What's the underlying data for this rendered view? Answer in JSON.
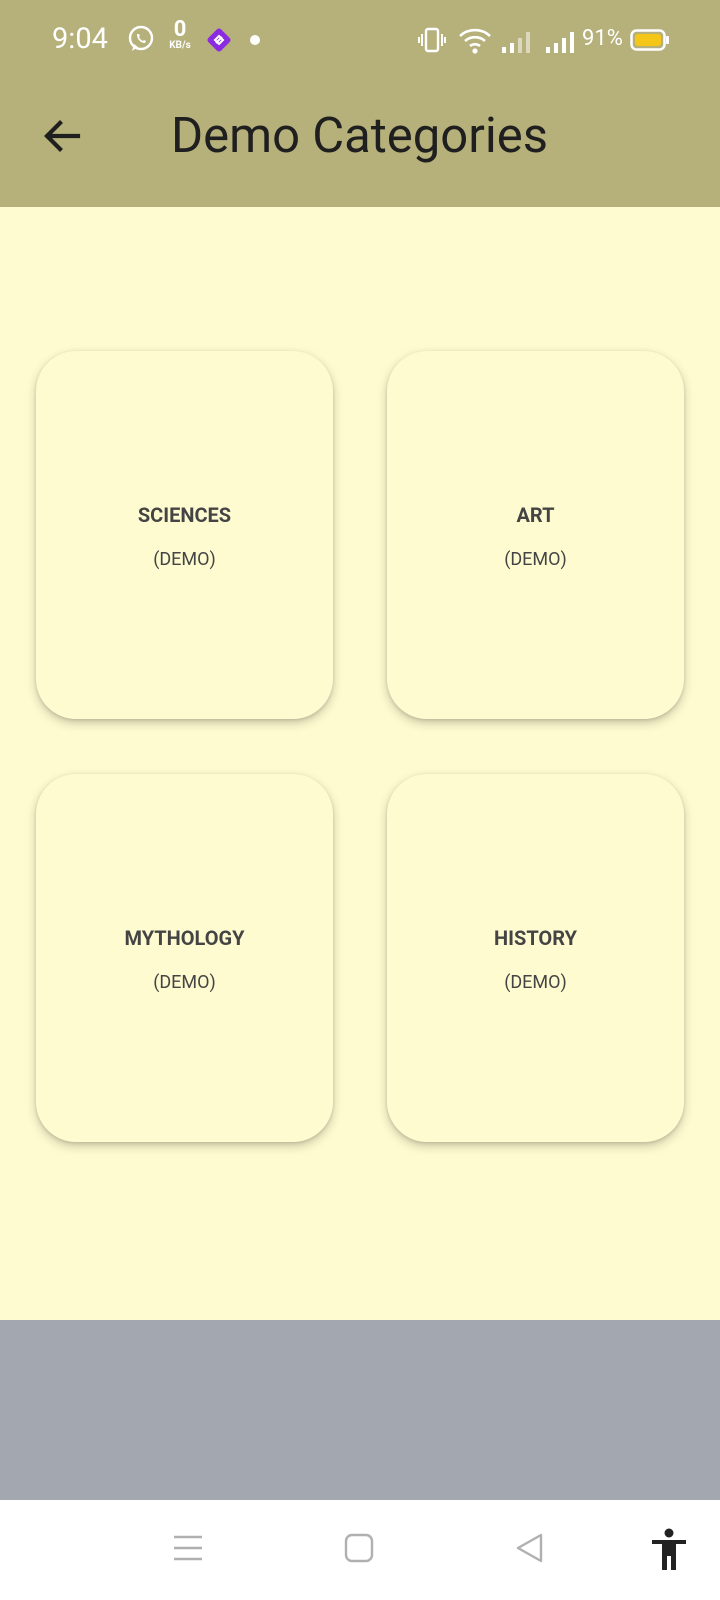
{
  "status_bar": {
    "time": "9:04",
    "net_speed_value": "0",
    "net_speed_unit": "KB/s",
    "battery_percent": "91%",
    "icons": [
      "whatsapp-icon",
      "kbs-indicator",
      "app-icon",
      "notification-dot",
      "vibrate-icon",
      "wifi-icon",
      "signal-icon",
      "signal-icon",
      "battery-icon"
    ],
    "battery_color": "#f5c518"
  },
  "app_bar": {
    "title": "Demo Categories",
    "background": "#b6b07a"
  },
  "categories": [
    {
      "name": "SCIENCES",
      "tag": "(DEMO)"
    },
    {
      "name": "ART",
      "tag": "(DEMO)"
    },
    {
      "name": "MYTHOLOGY",
      "tag": "(DEMO)"
    },
    {
      "name": "HISTORY",
      "tag": "(DEMO)"
    }
  ],
  "colors": {
    "page_bg": "#fffbd0",
    "band": "#a3a7b0"
  },
  "nav_bar": {
    "buttons": [
      "menu-icon",
      "home-icon",
      "back-icon",
      "accessibility-icon"
    ]
  }
}
